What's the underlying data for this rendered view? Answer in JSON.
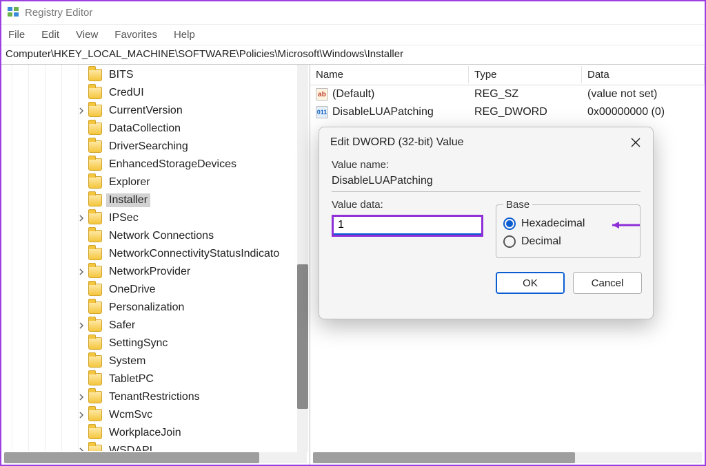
{
  "window": {
    "title": "Registry Editor"
  },
  "menu": {
    "items": [
      "File",
      "Edit",
      "View",
      "Favorites",
      "Help"
    ]
  },
  "address": "Computer\\HKEY_LOCAL_MACHINE\\SOFTWARE\\Policies\\Microsoft\\Windows\\Installer",
  "tree": {
    "items": [
      {
        "label": "BITS",
        "expander": "none"
      },
      {
        "label": "CredUI",
        "expander": "none"
      },
      {
        "label": "CurrentVersion",
        "expander": "closed"
      },
      {
        "label": "DataCollection",
        "expander": "none"
      },
      {
        "label": "DriverSearching",
        "expander": "none"
      },
      {
        "label": "EnhancedStorageDevices",
        "expander": "none"
      },
      {
        "label": "Explorer",
        "expander": "none"
      },
      {
        "label": "Installer",
        "expander": "none",
        "selected": true
      },
      {
        "label": "IPSec",
        "expander": "closed"
      },
      {
        "label": "Network Connections",
        "expander": "none"
      },
      {
        "label": "NetworkConnectivityStatusIndicato",
        "expander": "none"
      },
      {
        "label": "NetworkProvider",
        "expander": "closed"
      },
      {
        "label": "OneDrive",
        "expander": "none"
      },
      {
        "label": "Personalization",
        "expander": "none"
      },
      {
        "label": "Safer",
        "expander": "closed"
      },
      {
        "label": "SettingSync",
        "expander": "none"
      },
      {
        "label": "System",
        "expander": "none"
      },
      {
        "label": "TabletPC",
        "expander": "none"
      },
      {
        "label": "TenantRestrictions",
        "expander": "closed"
      },
      {
        "label": "WcmSvc",
        "expander": "closed"
      },
      {
        "label": "WorkplaceJoin",
        "expander": "none"
      },
      {
        "label": "WSDAPI",
        "expander": "closed"
      }
    ]
  },
  "list": {
    "columns": {
      "name": "Name",
      "type": "Type",
      "data": "Data"
    },
    "rows": [
      {
        "icon": "ab",
        "name": "(Default)",
        "type": "REG_SZ",
        "data": "(value not set)"
      },
      {
        "icon": "num",
        "name": "DisableLUAPatching",
        "type": "REG_DWORD",
        "data": "0x00000000 (0)"
      }
    ]
  },
  "dialog": {
    "title": "Edit DWORD (32-bit) Value",
    "valuename_label": "Value name:",
    "valuename": "DisableLUAPatching",
    "valuedata_label": "Value data:",
    "valuedata": "1",
    "base_label": "Base",
    "radio_hex": "Hexadecimal",
    "radio_dec": "Decimal",
    "base_selected": "hex",
    "ok": "OK",
    "cancel": "Cancel"
  }
}
